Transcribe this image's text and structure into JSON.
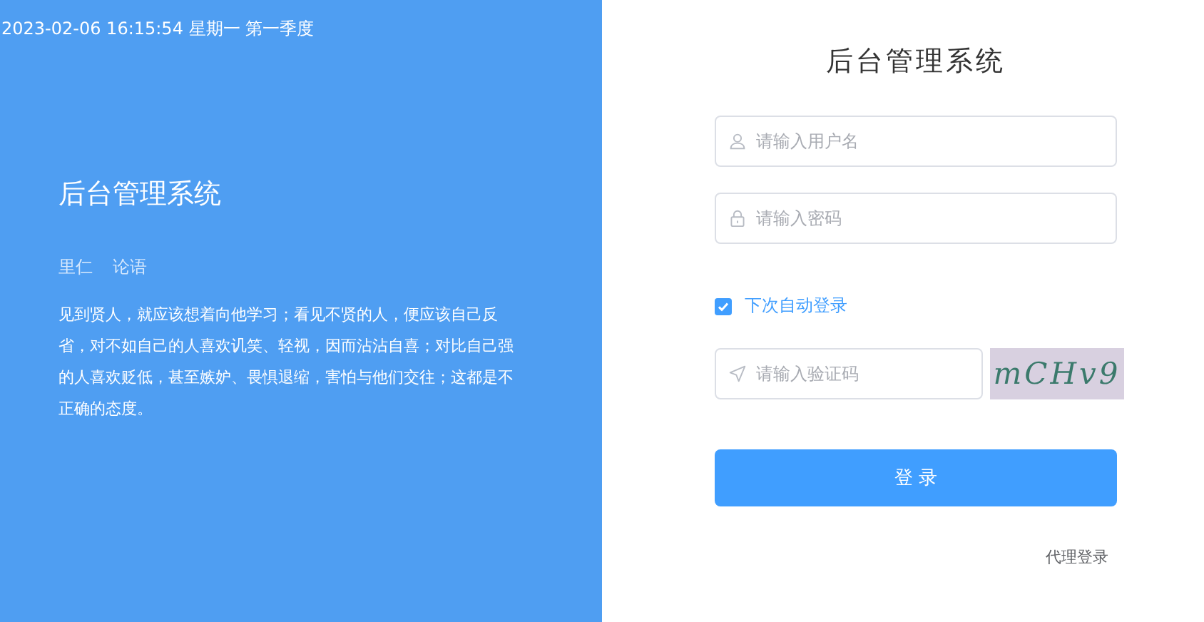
{
  "left_panel": {
    "datetime": "2023-02-06 16:15:54 星期一 第一季度",
    "title": "后台管理系统",
    "source": [
      "里仁",
      "论语"
    ],
    "quote": "见到贤人，就应该想着向他学习；看见不贤的人，便应该自己反省，对不如自己的人喜欢讥笑、轻视，因而沾沾自喜；对比自己强的人喜欢贬低，甚至嫉妒、畏惧退缩，害怕与他们交往；这都是不正确的态度。"
  },
  "login_form": {
    "title": "后台管理系统",
    "fields": [
      {
        "kind": "user",
        "placeholder": "请输入用户名"
      },
      {
        "kind": "lock",
        "placeholder": "请输入密码"
      }
    ],
    "remember": {
      "label": "下次自动登录",
      "checked": true
    },
    "captcha": {
      "placeholder": "请输入验证码",
      "code": "mCHv9"
    },
    "submit": "登 录",
    "agent_login": "代理登录"
  }
}
